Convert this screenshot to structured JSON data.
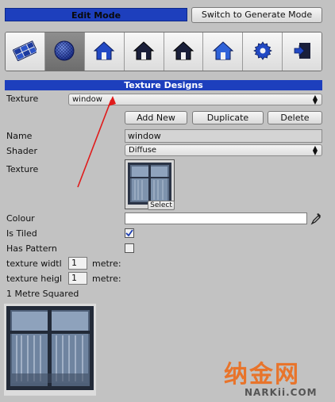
{
  "header": {
    "mode_title": "Edit Mode",
    "switch_button": "Switch to Generate Mode"
  },
  "toolbar": {
    "tools": [
      {
        "icon": "texture-tiles-icon",
        "active": false
      },
      {
        "icon": "texture-sphere-icon",
        "active": true
      },
      {
        "icon": "house-blue-icon",
        "active": false
      },
      {
        "icon": "house-dark-icon",
        "active": false
      },
      {
        "icon": "house-dark-icon",
        "active": false
      },
      {
        "icon": "house-blue-icon",
        "active": false
      },
      {
        "icon": "gear-icon",
        "active": false
      },
      {
        "icon": "export-icon",
        "active": false
      }
    ]
  },
  "section": {
    "title": "Texture Designs"
  },
  "texture_select": {
    "label": "Texture",
    "value": "window"
  },
  "actions": {
    "add_new": "Add New",
    "duplicate": "Duplicate",
    "delete": "Delete"
  },
  "form": {
    "name_label": "Name",
    "name_value": "window",
    "shader_label": "Shader",
    "shader_value": "Diffuse",
    "texture_label": "Texture",
    "texture_select_button": "Select",
    "colour_label": "Colour",
    "colour_value": "#ffffff",
    "is_tiled_label": "Is Tiled",
    "is_tiled": true,
    "has_pattern_label": "Has Pattern",
    "has_pattern": false,
    "texture_width_label": "texture widtl",
    "texture_width_value": "1",
    "texture_width_unit": "metre:",
    "texture_height_label": "texture heigl",
    "texture_height_value": "1",
    "texture_height_unit": "metre:",
    "preview_label": "1 Metre Squared"
  },
  "watermark": {
    "cn": "纳金网",
    "en": "NARKii.COM"
  },
  "colors": {
    "accent_blue": "#1d3fbd",
    "annotation_arrow": "#e01b1b",
    "watermark_orange": "#e8742b"
  }
}
